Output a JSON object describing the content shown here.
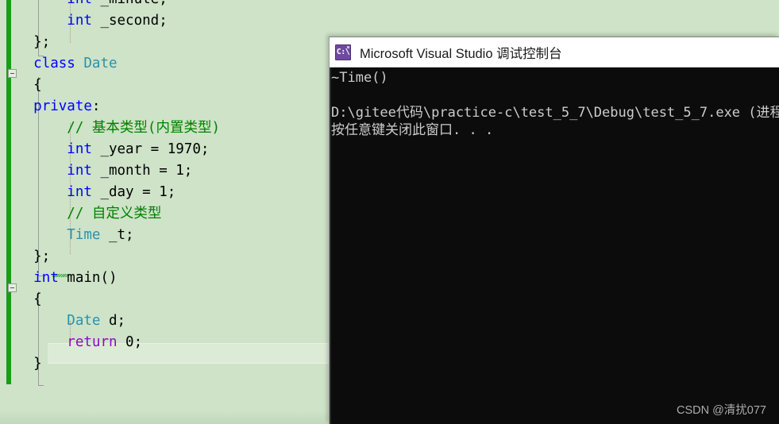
{
  "editor": {
    "app": "Visual Studio Code Editor",
    "background_color": "#cee3c8",
    "current_line_index": 16,
    "colors": {
      "keyword": "#0000ff",
      "user_type": "#2b91af",
      "comment": "#008000",
      "control_keyword": "#8f08c4",
      "plain_text": "#000000",
      "change_bar": "#1a9c1a",
      "current_line_highlight": "#dcebd6"
    },
    "lines": [
      {
        "indent": 0,
        "tokens": [
          {
            "t": "        ",
            "c": "pl"
          },
          {
            "t": "int",
            "c": "k"
          },
          {
            "t": " _minute;",
            "c": "pl"
          }
        ]
      },
      {
        "indent": 0,
        "tokens": [
          {
            "t": "        ",
            "c": "pl"
          },
          {
            "t": "int",
            "c": "k"
          },
          {
            "t": " _second;",
            "c": "pl"
          }
        ]
      },
      {
        "indent": 0,
        "tokens": [
          {
            "t": "    };",
            "c": "pl"
          }
        ]
      },
      {
        "indent": 0,
        "tokens": [
          {
            "t": "    ",
            "c": "pl"
          },
          {
            "t": "class",
            "c": "k"
          },
          {
            "t": " ",
            "c": "pl"
          },
          {
            "t": "Date",
            "c": "ty"
          }
        ]
      },
      {
        "indent": 0,
        "tokens": [
          {
            "t": "    {",
            "c": "pl"
          }
        ]
      },
      {
        "indent": 0,
        "tokens": [
          {
            "t": "    ",
            "c": "pl"
          },
          {
            "t": "private",
            "c": "k"
          },
          {
            "t": ":",
            "c": "pl"
          }
        ]
      },
      {
        "indent": 0,
        "tokens": [
          {
            "t": "        ",
            "c": "pl"
          },
          {
            "t": "// 基本类型(内置类型)",
            "c": "cmt"
          }
        ]
      },
      {
        "indent": 0,
        "tokens": [
          {
            "t": "        ",
            "c": "pl"
          },
          {
            "t": "int",
            "c": "k"
          },
          {
            "t": " _year = 1970;",
            "c": "pl"
          }
        ]
      },
      {
        "indent": 0,
        "tokens": [
          {
            "t": "        ",
            "c": "pl"
          },
          {
            "t": "int",
            "c": "k"
          },
          {
            "t": " _month = 1;",
            "c": "pl"
          }
        ]
      },
      {
        "indent": 0,
        "tokens": [
          {
            "t": "        ",
            "c": "pl"
          },
          {
            "t": "int",
            "c": "k"
          },
          {
            "t": " _day = 1;",
            "c": "pl"
          }
        ]
      },
      {
        "indent": 0,
        "tokens": [
          {
            "t": "        ",
            "c": "pl"
          },
          {
            "t": "// 自定义类型",
            "c": "cmt"
          }
        ]
      },
      {
        "indent": 0,
        "tokens": [
          {
            "t": "        ",
            "c": "pl"
          },
          {
            "t": "Time",
            "c": "ty"
          },
          {
            "t": " _t;",
            "c": "pl"
          }
        ]
      },
      {
        "indent": 0,
        "tokens": [
          {
            "t": "    };",
            "c": "pl"
          }
        ]
      },
      {
        "indent": 0,
        "tokens": [
          {
            "t": "    ",
            "c": "pl"
          },
          {
            "t": "int",
            "c": "k"
          },
          {
            "t": " main()",
            "c": "pl"
          }
        ]
      },
      {
        "indent": 0,
        "tokens": [
          {
            "t": "    {",
            "c": "pl"
          }
        ]
      },
      {
        "indent": 0,
        "tokens": [
          {
            "t": "        ",
            "c": "pl"
          },
          {
            "t": "Date",
            "c": "ty"
          },
          {
            "t": " d;",
            "c": "pl"
          }
        ]
      },
      {
        "indent": 0,
        "tokens": [
          {
            "t": "        ",
            "c": "pl"
          },
          {
            "t": "return",
            "c": "ctl"
          },
          {
            "t": " 0;",
            "c": "pl"
          }
        ]
      },
      {
        "indent": 0,
        "tokens": [
          {
            "t": "    }",
            "c": "pl"
          }
        ]
      }
    ]
  },
  "console": {
    "title": "Microsoft Visual Studio 调试控制台",
    "icon": "console-cmd-icon",
    "icon_glyph": "C:\\",
    "background_color": "#0c0c0c",
    "text_color": "#cccccc",
    "output_lines": [
      "~Time()",
      "",
      "D:\\gitee代码\\practice-c\\test_5_7\\Debug\\test_5_7.exe (进程",
      "按任意键关闭此窗口. . ."
    ]
  },
  "watermark": {
    "text": "CSDN @清扰077"
  }
}
